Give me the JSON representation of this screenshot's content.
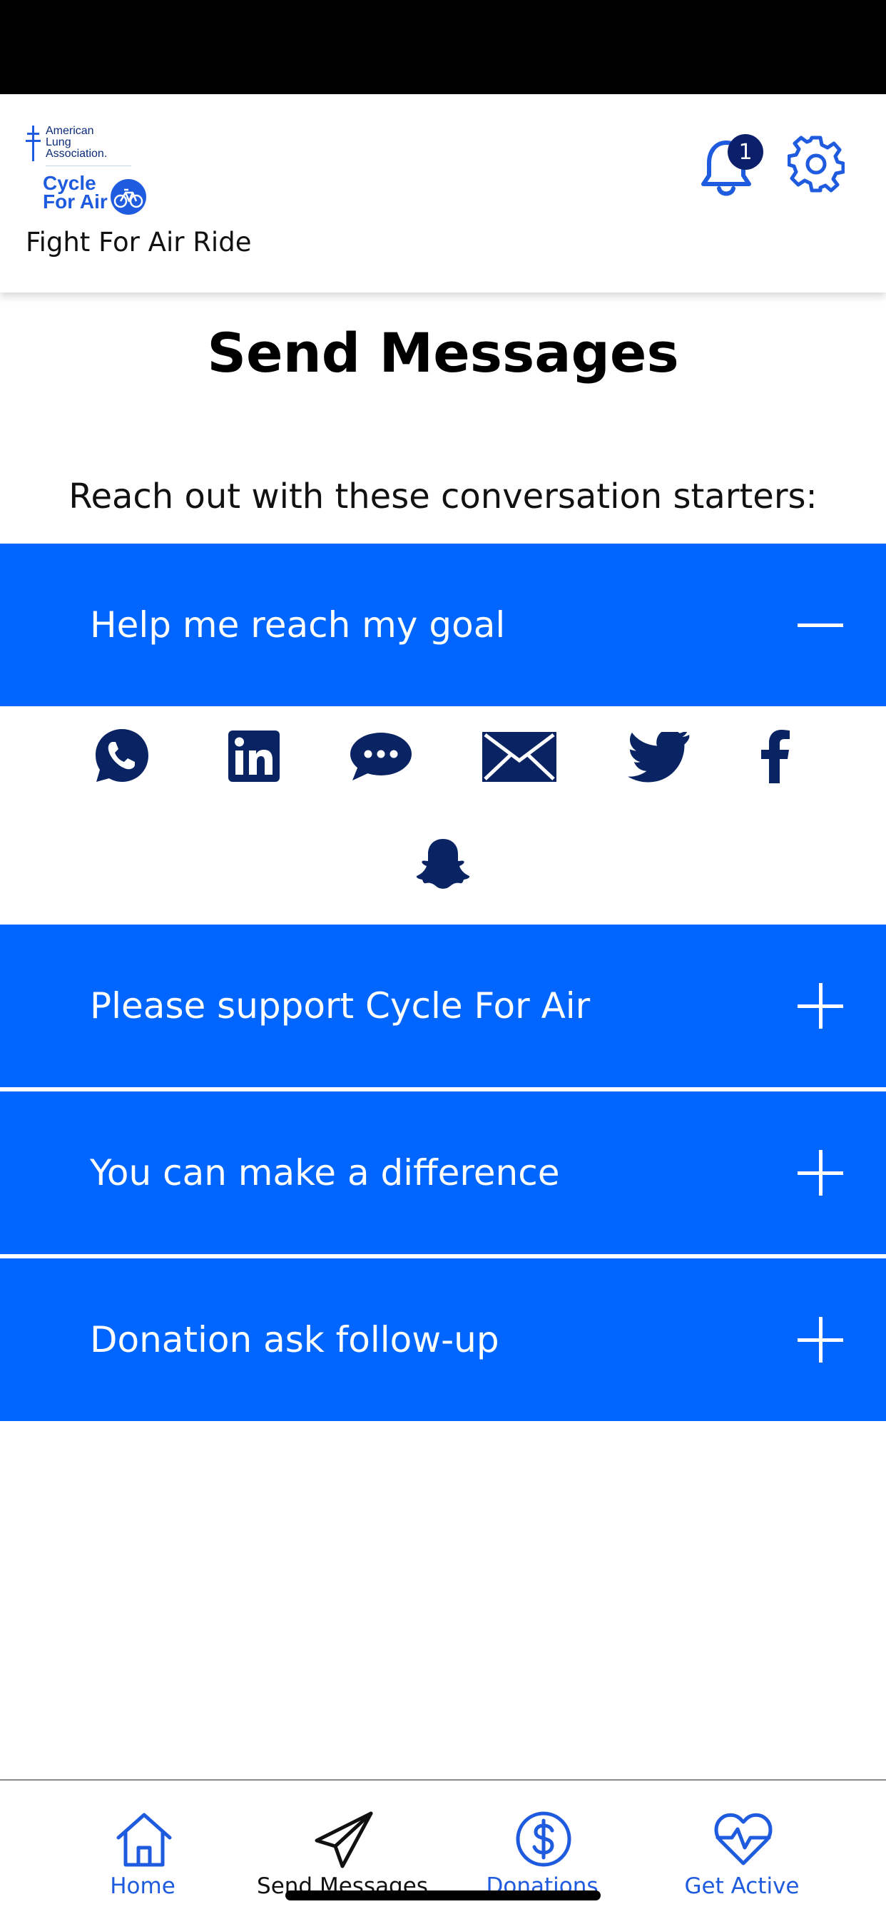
{
  "header": {
    "logo_org_text": "American\nLung\nAssociation.",
    "logo_brand_text": "Cycle\nFor Air",
    "event_title": "Fight For Air Ride",
    "notification_count": "1",
    "notification_icon": "bell-icon",
    "settings_icon": "gear-icon"
  },
  "page": {
    "title": "Send Messages",
    "intro": "Reach out with these conversation starters:"
  },
  "accordions": [
    {
      "label": "Help me reach my goal",
      "expanded": true
    },
    {
      "label": "Please support Cycle For Air",
      "expanded": false
    },
    {
      "label": "You can make a difference",
      "expanded": false
    },
    {
      "label": "Donation ask follow-up",
      "expanded": false
    }
  ],
  "share_icons": [
    "whatsapp-icon",
    "linkedin-icon",
    "sms-icon",
    "email-icon",
    "twitter-icon",
    "facebook-icon",
    "snapchat-icon"
  ],
  "tabs": [
    {
      "label": "Home",
      "icon": "home-icon",
      "active": false
    },
    {
      "label": "Send Messages",
      "icon": "paper-plane-icon",
      "active": true
    },
    {
      "label": "Donations",
      "icon": "dollar-icon",
      "active": false
    },
    {
      "label": "Get Active",
      "icon": "heartbeat-icon",
      "active": false
    }
  ],
  "colors": {
    "accent": "#0066ff",
    "brand_blue": "#1f5bde",
    "navy": "#0c1f6b",
    "share_icon": "#0a2463"
  }
}
